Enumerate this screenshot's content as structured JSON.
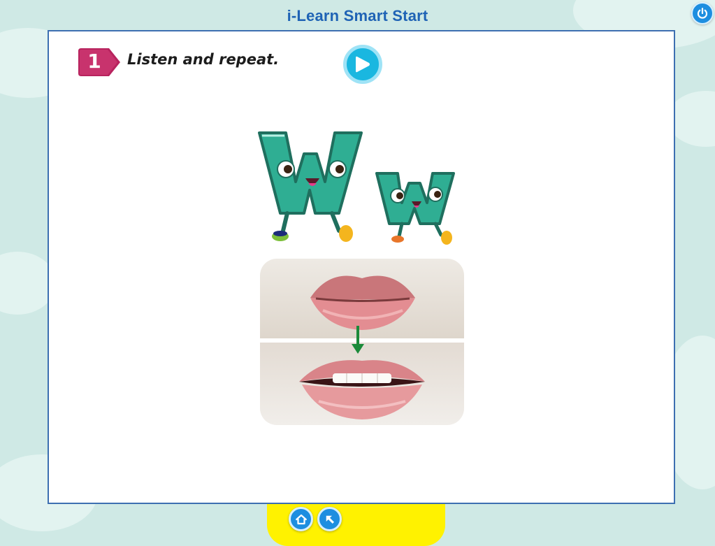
{
  "app": {
    "title": "i-Learn Smart Start"
  },
  "lesson": {
    "step_number": "1",
    "instruction": "Listen and repeat.",
    "letters": [
      "W",
      "w"
    ]
  },
  "icons": {
    "power": "power-icon",
    "play": "play-icon",
    "home": "home-icon",
    "back": "back-arrow-icon"
  },
  "colors": {
    "title": "#1f63b5",
    "badge": "#b8235e",
    "letter_fill": "#2fae93",
    "play_button": "#1ab7e0",
    "bottom_bar": "#fff200",
    "nav_button": "#1d8ee0"
  }
}
